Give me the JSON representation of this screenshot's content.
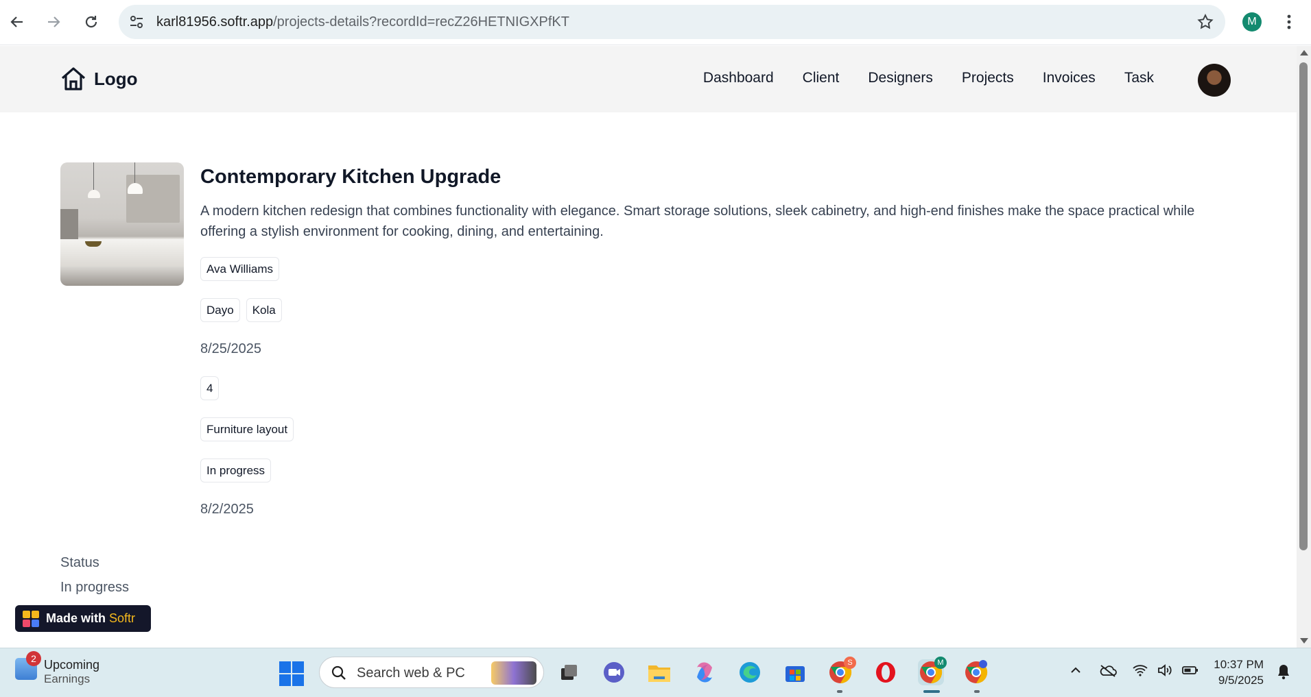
{
  "browser": {
    "url_host": "karl81956.softr.app",
    "url_path": "/projects-details?recordId=recZ26HETNIGXPfKT",
    "profile_initial": "M"
  },
  "site": {
    "logo_text": "Logo",
    "nav": [
      "Dashboard",
      "Client",
      "Designers",
      "Projects",
      "Invoices",
      "Task"
    ]
  },
  "project": {
    "title": "Contemporary Kitchen Upgrade",
    "description": "A modern kitchen redesign that combines functionality with elegance. Smart storage solutions, sleek cabinetry, and high-end finishes make the space practical while offering a stylish environment for cooking, dining, and entertaining.",
    "client": "Ava Williams",
    "designers": [
      "Dayo",
      "Kola"
    ],
    "start_date": "8/25/2025",
    "count": "4",
    "task": "Furniture layout",
    "status_tag": "In progress",
    "end_date": "8/2/2025",
    "status_label": "Status",
    "status_value": "In progress"
  },
  "badge": {
    "prefix": "Made with",
    "brand": "Softr",
    "brand_color": "#f6b91d"
  },
  "taskbar": {
    "widget_title": "Upcoming",
    "widget_subtitle": "Earnings",
    "widget_badge": "2",
    "search_placeholder": "Search web & PC",
    "time": "10:37 PM",
    "date": "9/5/2025",
    "chrome_badge_s": "S",
    "chrome_badge_m": "M"
  },
  "colors": {
    "header_bg": "#f4f4f4",
    "accent_profile": "#138a6f",
    "taskbar_bg": "#dcebf0"
  }
}
